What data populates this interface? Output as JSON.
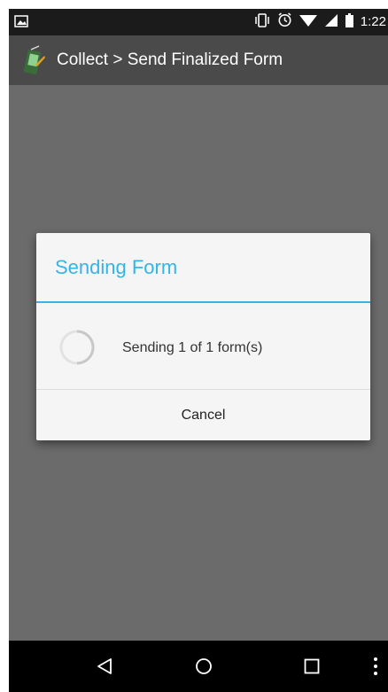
{
  "status_bar": {
    "time": "1:22",
    "icons": [
      "image-icon",
      "vibrate-icon",
      "alarm-icon",
      "wifi-icon",
      "signal-icon",
      "battery-icon"
    ]
  },
  "app_bar": {
    "title": "Collect > Send Finalized Form",
    "icon": "collect-app-icon"
  },
  "dialog": {
    "title": "Sending Form",
    "message": "Sending 1 of 1 form(s)",
    "cancel_label": "Cancel",
    "accent_color": "#33b5e5"
  },
  "nav_bar": {
    "items": [
      "back-icon",
      "home-icon",
      "recents-icon",
      "overflow-menu-icon"
    ]
  }
}
